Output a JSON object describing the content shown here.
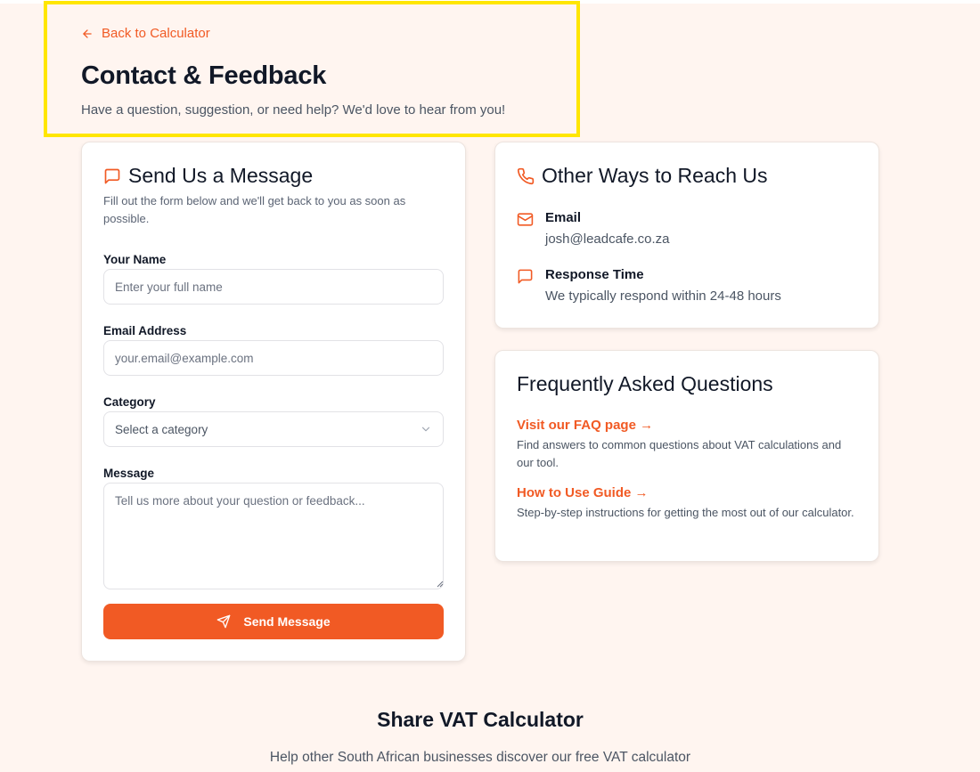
{
  "header": {
    "back_link": "Back to Calculator",
    "title": "Contact & Feedback",
    "subtitle": "Have a question, suggestion, or need help? We'd love to hear from you!"
  },
  "form": {
    "heading": "Send Us a Message",
    "description": "Fill out the form below and we'll get back to you as soon as possible.",
    "name_label": "Your Name",
    "name_placeholder": "Enter your full name",
    "email_label": "Email Address",
    "email_placeholder": "your.email@example.com",
    "category_label": "Category",
    "category_value": "Select a category",
    "message_label": "Message",
    "message_placeholder": "Tell us more about your question or feedback...",
    "submit_label": "Send Message"
  },
  "contact": {
    "heading": "Other Ways to Reach Us",
    "items": [
      {
        "title": "Email",
        "value": "josh@leadcafe.co.za",
        "icon": "mail-icon"
      },
      {
        "title": "Response Time",
        "value": "We typically respond within 24-48 hours",
        "icon": "message-square-icon"
      }
    ]
  },
  "faq": {
    "heading": "Frequently Asked Questions",
    "items": [
      {
        "link": "Visit our FAQ page →",
        "description": "Find answers to common questions about VAT calculations and our tool."
      },
      {
        "link": "How to Use Guide →",
        "description": "Step-by-step instructions for getting the most out of our calculator."
      }
    ]
  },
  "share": {
    "title": "Share VAT Calculator",
    "subtitle": "Help other South African businesses discover our free VAT calculator"
  },
  "colors": {
    "accent": "#f15a24",
    "background": "#fff5f0",
    "highlight_border": "#ffe600"
  }
}
